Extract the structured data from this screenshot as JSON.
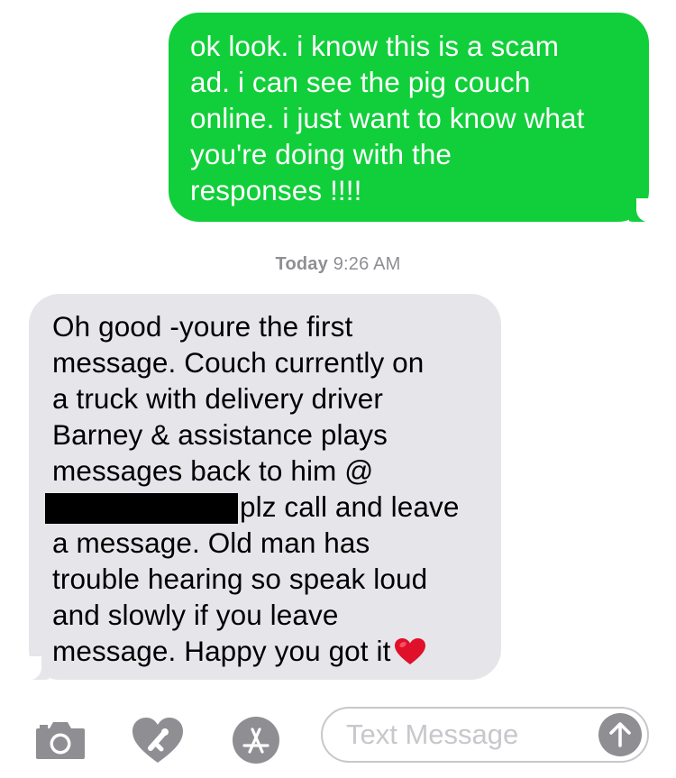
{
  "messages": [
    {
      "direction": "outgoing",
      "lines": [
        "ok look. i know this is a scam",
        "ad. i can see the pig couch",
        "online. i just want to know what",
        "you're doing with the",
        "responses !!!!"
      ]
    },
    {
      "direction": "incoming",
      "lines": [
        "Oh good -youre the first",
        "message.  Couch currently on",
        "a truck with delivery driver",
        "Barney & assistance plays",
        "messages back to him @",
        "plz call and leave",
        "a message.  Old man has",
        "trouble hearing so speak loud",
        "and slowly if you leave",
        "message.  Happy you got it"
      ],
      "emoji": "red-heart"
    }
  ],
  "timestamp": {
    "day": "Today",
    "time": "9:26 AM"
  },
  "toolbar": {
    "camera_icon": "camera-icon",
    "digital_touch_icon": "heart-touch-icon",
    "apps_icon": "app-store-icon",
    "input_placeholder": "Text Message",
    "input_value": "",
    "send_icon": "arrow-up-icon"
  },
  "colors": {
    "outgoing_bubble": "#11cf3a",
    "incoming_bubble": "#e5e5ea",
    "timestamp_text": "#8e8e93",
    "toolbar_icons": "#8e8e93",
    "input_border": "#c7c7cc",
    "redaction": "#000000",
    "heart": "#e0102a"
  }
}
